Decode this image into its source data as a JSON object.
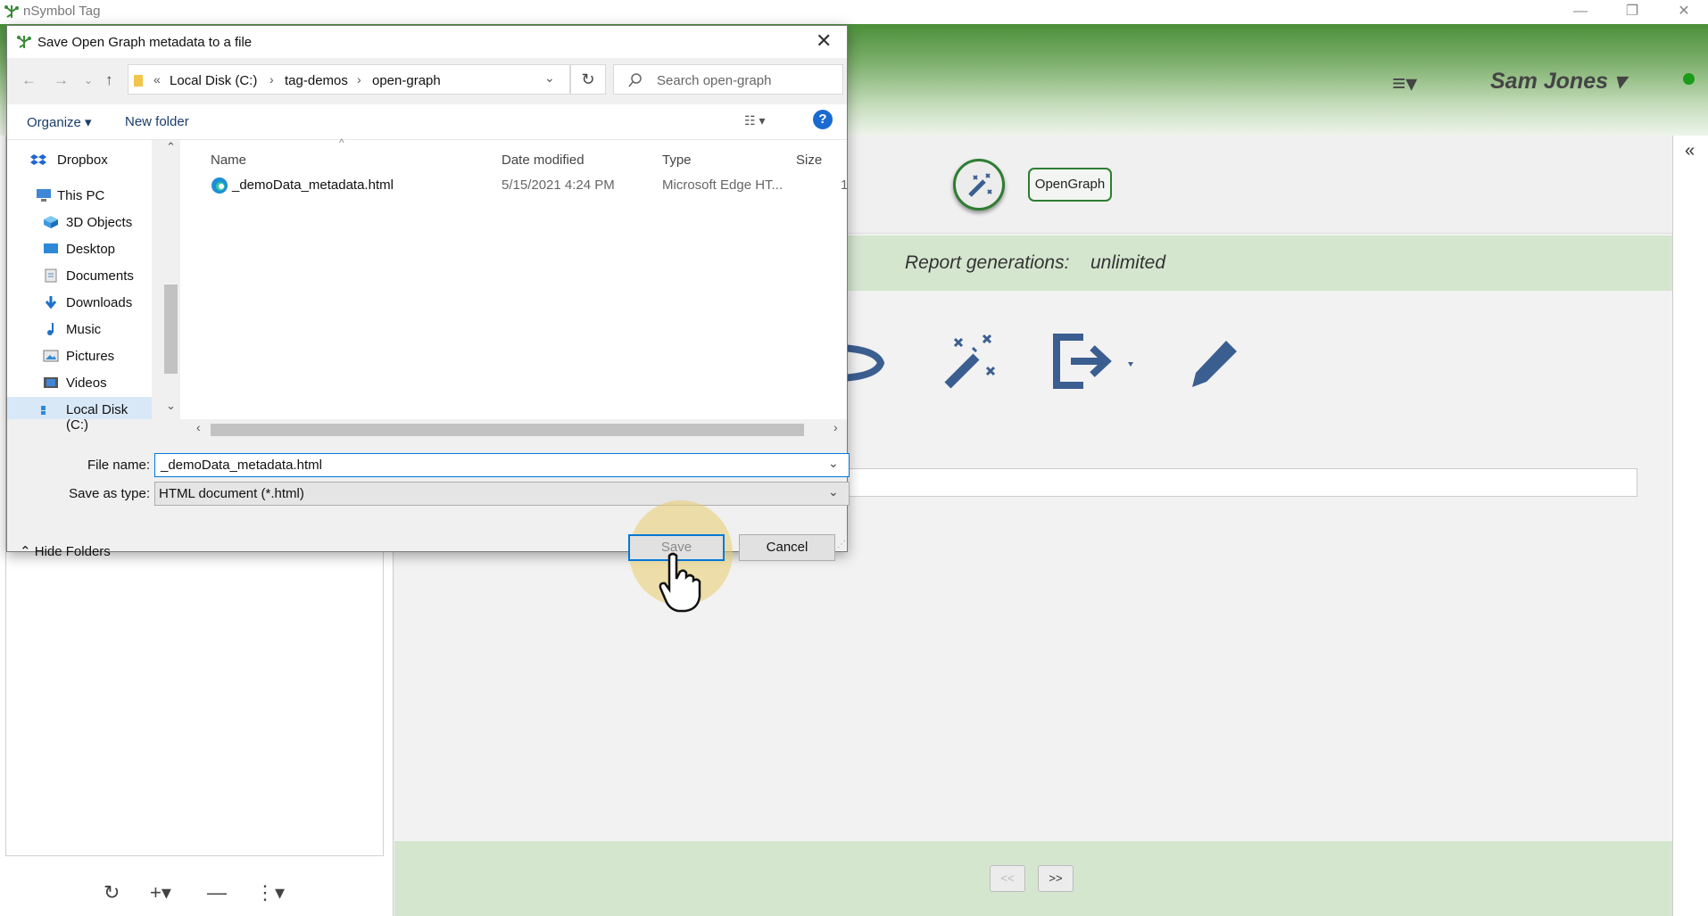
{
  "app": {
    "title": "nSymbol Tag",
    "window_controls": [
      "—",
      "❐",
      "✕"
    ]
  },
  "header": {
    "menu_icon": "hamburger-menu-icon",
    "user_name": "Sam Jones ▾"
  },
  "main": {
    "opengraph_button": "OpenGraph",
    "report_label": "Report generations:",
    "report_value": "unlimited",
    "pager": {
      "prev": "<<",
      "next": ">>"
    },
    "collapse_icon": "«"
  },
  "left_toolbar": {
    "refresh": "↻",
    "add": "+▾",
    "remove": "—",
    "more": "⋮▾"
  },
  "dialog": {
    "title": "Save Open Graph metadata to a file",
    "close": "✕",
    "address": {
      "prefix": "«",
      "segments": [
        "Local Disk (C:)",
        "tag-demos",
        "open-graph"
      ]
    },
    "search_placeholder": "Search open-graph",
    "toolbar": {
      "organize": "Organize ▾",
      "new_folder": "New folder",
      "help": "?"
    },
    "nav_items": [
      {
        "label": "Dropbox",
        "icon": "dropbox-icon"
      },
      {
        "label": "This PC",
        "icon": "pc-icon"
      },
      {
        "label": "3D Objects",
        "icon": "3d-objects-icon"
      },
      {
        "label": "Desktop",
        "icon": "desktop-icon"
      },
      {
        "label": "Documents",
        "icon": "documents-icon"
      },
      {
        "label": "Downloads",
        "icon": "downloads-icon"
      },
      {
        "label": "Music",
        "icon": "music-icon"
      },
      {
        "label": "Pictures",
        "icon": "pictures-icon"
      },
      {
        "label": "Videos",
        "icon": "videos-icon"
      },
      {
        "label": "Local Disk (C:)",
        "icon": "disk-icon"
      }
    ],
    "columns": {
      "name": "Name",
      "date": "Date modified",
      "type": "Type",
      "size": "Size"
    },
    "files": [
      {
        "name": "_demoData_metadata.html",
        "date": "5/15/2021 4:24 PM",
        "type": "Microsoft Edge HT...",
        "size": "1"
      }
    ],
    "file_name_label": "File name:",
    "file_name_value": "_demoData_metadata.html",
    "save_type_label": "Save as type:",
    "save_type_value": "HTML document (*.html)",
    "hide_folders": "Hide Folders",
    "save_button": "Save",
    "cancel_button": "Cancel"
  },
  "colors": {
    "header_green": "#4a8f3a",
    "accent_green": "#2e7d32",
    "report_bar": "#d5e6cf",
    "icon_blue": "#3b5e91",
    "windows_blue": "#0078d7"
  }
}
